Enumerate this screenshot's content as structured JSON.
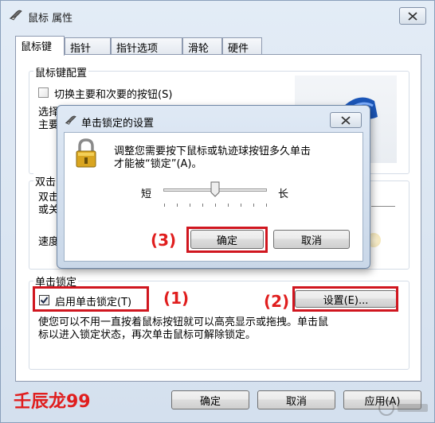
{
  "window": {
    "title": "鼠标 属性",
    "tabs": [
      "鼠标键",
      "指针",
      "指针选项",
      "滑轮",
      "硬件"
    ]
  },
  "button_config": {
    "group_label": "鼠标键配置",
    "swap_label": "切换主要和次要的按钮(S)",
    "desc_line1": "选择",
    "desc_line2": "主要"
  },
  "double_click": {
    "group_label": "双击",
    "desc_line1": "双击",
    "desc_line2": "或关",
    "speed_label": "速度"
  },
  "clicklock": {
    "group_label": "单击锁定",
    "checkbox_label": "启用单击锁定(T)",
    "checked": true,
    "settings_button": "设置(E)...",
    "description_line1": "使您可以不用一直按着鼠标按钮就可以高亮显示或拖拽。单击鼠",
    "description_line2": "标以进入锁定状态，再次单击鼠标可解除锁定。"
  },
  "footer": {
    "watermark": "壬辰龙99",
    "ok": "确定",
    "cancel": "取消",
    "apply": "应用(A)"
  },
  "dialog": {
    "title": "单击锁定的设置",
    "message_line1": "调整您需要按下鼠标或轨迹球按钮多久单击",
    "message_line2": "才能被“锁定”(A)。",
    "short_label": "短",
    "long_label": "长",
    "slider_fraction": 0.5,
    "ok": "确定",
    "cancel": "取消"
  },
  "annotations": {
    "step1": "(1)",
    "step2": "(2)",
    "step3": "(3)",
    "color": "#e01e1e"
  }
}
